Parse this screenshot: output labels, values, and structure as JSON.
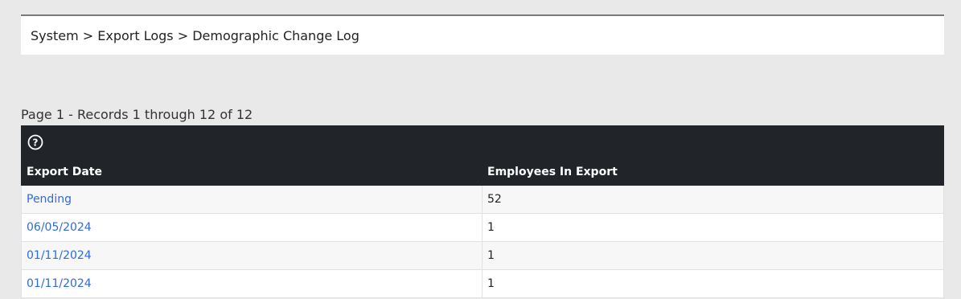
{
  "breadcrumb": {
    "items": [
      "System",
      "Export Logs",
      "Demographic Change Log"
    ],
    "separator": ">"
  },
  "paging": {
    "summary": "Page 1 - Records 1 through 12 of 12"
  },
  "grid": {
    "help_icon": "question-circle-icon",
    "columns": [
      "Export Date",
      "Employees In Export"
    ],
    "rows": [
      {
        "export_date": "Pending",
        "employees": "52"
      },
      {
        "export_date": "06/05/2024",
        "employees": "1"
      },
      {
        "export_date": "01/11/2024",
        "employees": "1"
      },
      {
        "export_date": "01/11/2024",
        "employees": "1"
      }
    ]
  },
  "colors": {
    "header_bg": "#212529",
    "link": "#2f6cd6",
    "page_bg": "#e9e9e9"
  }
}
